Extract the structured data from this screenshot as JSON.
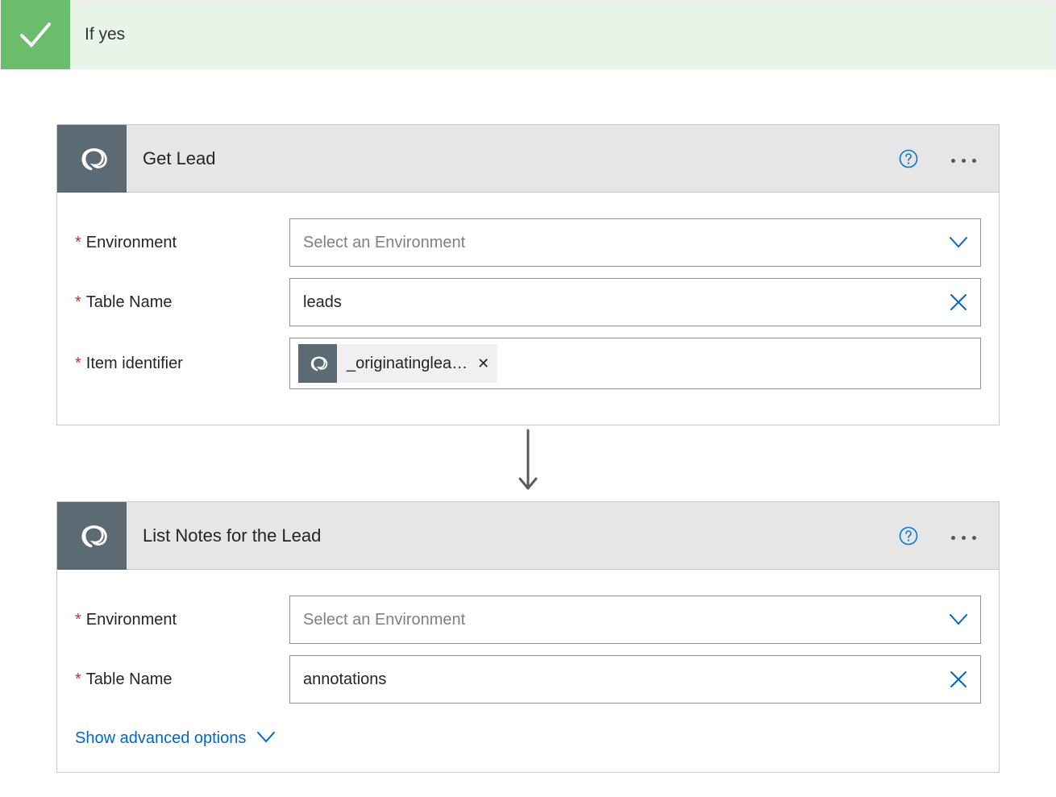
{
  "condition": {
    "label": "If yes"
  },
  "icons": {
    "dataverse_swirl": "dataverse-icon",
    "help": "help-icon",
    "more": "more-icon",
    "chevron_down": "chevron-down-icon",
    "clear_x": "clear-icon",
    "check": "check-icon"
  },
  "card1": {
    "title": "Get Lead",
    "fields": {
      "environment": {
        "label": "Environment",
        "placeholder": "Select an Environment"
      },
      "table": {
        "label": "Table Name",
        "value": "leads"
      },
      "item_id": {
        "label": "Item identifier",
        "token": "_originatinglea…"
      }
    }
  },
  "card2": {
    "title": "List Notes for the Lead",
    "fields": {
      "environment": {
        "label": "Environment",
        "placeholder": "Select an Environment"
      },
      "table": {
        "label": "Table Name",
        "value": "annotations"
      }
    },
    "advanced_label": "Show advanced options"
  }
}
